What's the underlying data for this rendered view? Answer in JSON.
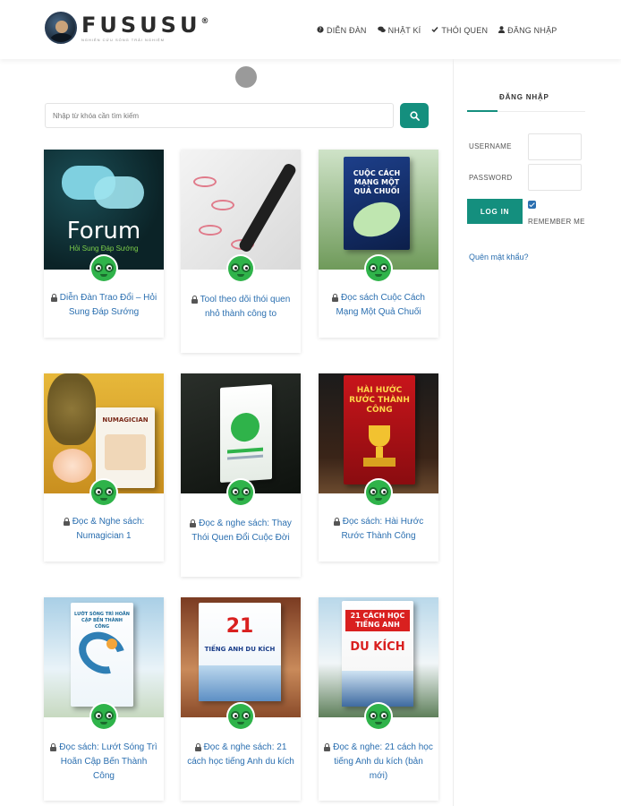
{
  "brand": {
    "name": "FUSUSU",
    "trademark": "®",
    "tagline": "NGHIÊN CỨU SỐNG TRẢI NGHIỆM"
  },
  "nav": {
    "items": [
      {
        "label": "DIỄN ĐÀN",
        "icon": "question-circle-icon"
      },
      {
        "label": "NHẬT KÍ",
        "icon": "comments-icon"
      },
      {
        "label": "THÓI QUEN",
        "icon": "check-icon"
      },
      {
        "label": "ĐĂNG NHẬP",
        "icon": "user-icon"
      }
    ]
  },
  "search": {
    "placeholder": "Nhập từ khóa cần tìm kiếm",
    "button_icon": "search-icon",
    "accent": "#148f7e"
  },
  "cards": [
    {
      "title": "Diễn Đàn Trao Đổi – Hỏi Sung Đáp Sướng",
      "image_text": "Forum",
      "image_subtext": "Hỏi Sung Đáp Sướng"
    },
    {
      "title": "Tool theo dõi thói quen nhỏ thành công to"
    },
    {
      "title": "Đọc sách Cuộc Cách Mạng Một Quả Chuối",
      "image_text": "CUỘC CÁCH MẠNG MỘT QUẢ CHUỐI"
    },
    {
      "title": "Đọc & Nghe sách: Numagician 1",
      "image_text": "NUMAGICIAN"
    },
    {
      "title": "Đọc & nghe sách: Thay Thói Quen Đổi Cuộc Đời"
    },
    {
      "title": "Đọc sách: Hài Hước Rước Thành Công",
      "image_text": "HÀI HƯỚC RƯỚC THÀNH CÔNG"
    },
    {
      "title": "Đọc sách: Lướt Sóng Trì Hoãn Cập Bến Thành Công",
      "image_text": "LƯỚT SÓNG TRÌ HOÃN CẬP BẾN THÀNH CÔNG"
    },
    {
      "title": "Đọc & nghe sách: 21 cách học tiếng Anh du kích",
      "image_text": "21",
      "image_subtext": "TIẾNG ANH DU KÍCH"
    },
    {
      "title": "Đọc & nghe: 21 cách học tiếng Anh du kích (bản mới)",
      "image_text": "21 CÁCH HỌC TIẾNG ANH",
      "image_subtext": "DU KÍCH"
    }
  ],
  "sidebar": {
    "heading": "ĐĂNG NHẬP",
    "username_label": "USERNAME",
    "password_label": "PASSWORD",
    "login_button": "LOG IN",
    "remember_label": "REMEMBER ME",
    "remember_checked": true,
    "forgot_link": "Quên mật khẩu?"
  }
}
